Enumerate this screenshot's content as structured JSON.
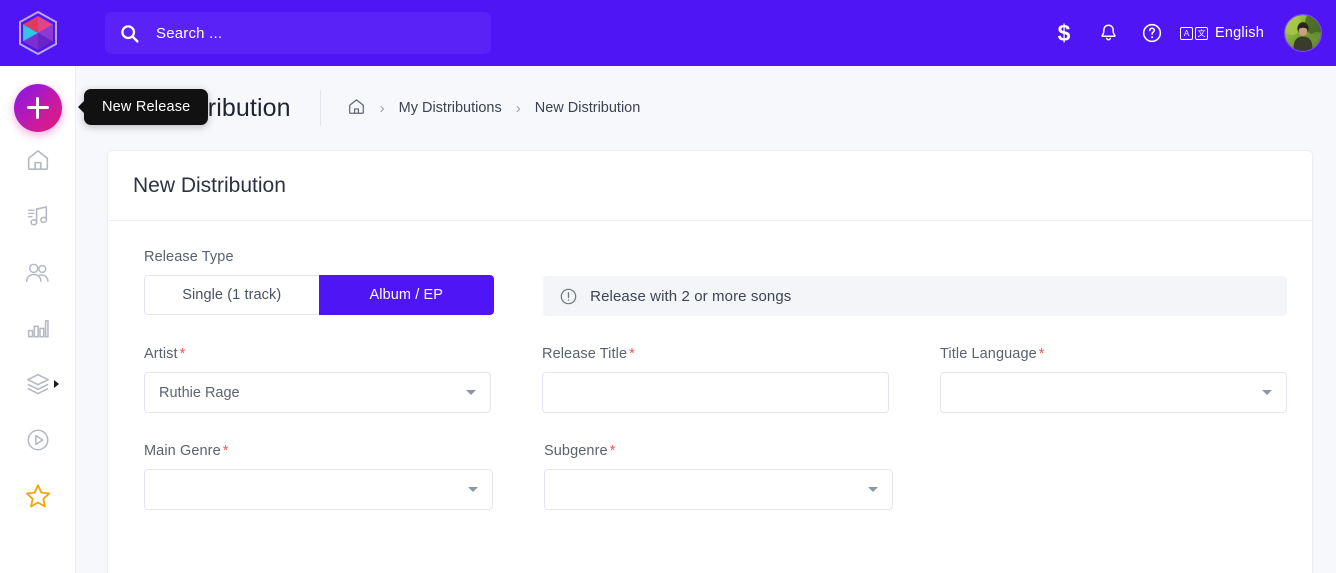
{
  "header": {
    "logo_icon": "gem-hexagon-logo",
    "search": {
      "placeholder": "Search ...",
      "value": "",
      "icon": "search-icon"
    },
    "wallet_icon": "dollar-icon",
    "notifications_icon": "bell-icon",
    "help_icon": "question-circle-icon",
    "language_icon": "translate-icon",
    "language_label": "English",
    "lang_box_left": "A",
    "lang_box_right": "文",
    "avatar_icon": "user-avatar"
  },
  "sidebar": {
    "new_release_button": {
      "icon": "plus-icon",
      "tooltip": "New Release"
    },
    "items": [
      {
        "icon": "home-icon",
        "name": "home"
      },
      {
        "icon": "music-note-icon",
        "name": "music"
      },
      {
        "icon": "users-icon",
        "name": "artists"
      },
      {
        "icon": "bar-chart-icon",
        "name": "analytics"
      },
      {
        "icon": "layers-icon",
        "name": "distributions",
        "has_submenu": true
      },
      {
        "icon": "play-circle-icon",
        "name": "player"
      },
      {
        "icon": "star-icon",
        "name": "favorites",
        "color": "#f0a500"
      }
    ]
  },
  "page": {
    "title": "New Distribution",
    "breadcrumb": {
      "home_icon": "home-icon",
      "separator": "›",
      "items": [
        {
          "label": "My Distributions",
          "link": true
        },
        {
          "label": "New Distribution",
          "link": false
        }
      ]
    }
  },
  "card": {
    "title": "New Distribution",
    "release_type": {
      "label": "Release Type",
      "options": [
        {
          "label": "Single (1 track)",
          "active": false
        },
        {
          "label": "Album / EP",
          "active": true
        }
      ]
    },
    "info_alert": {
      "icon": "info-circle-icon",
      "text": "Release with 2 or more songs"
    },
    "fields": [
      {
        "label": "Artist",
        "required": true,
        "type": "select",
        "value": "Ruthie Rage",
        "placeholder": ""
      },
      {
        "label": "Release Title",
        "required": true,
        "type": "text",
        "value": "",
        "placeholder": ""
      },
      {
        "label": "Title Language",
        "required": true,
        "type": "select",
        "value": "",
        "placeholder": ""
      },
      {
        "label": "Main Genre",
        "required": true,
        "type": "select",
        "value": "",
        "placeholder": ""
      },
      {
        "label": "Subgenre",
        "required": true,
        "type": "select",
        "value": "",
        "placeholder": ""
      }
    ],
    "required_marker": "*"
  },
  "colors": {
    "brand_purple": "#4f15f5",
    "search_bg": "#5b22f7",
    "required_red": "#ee5b5b",
    "star_gold": "#f0a500",
    "page_bg": "#f7f8fc"
  }
}
